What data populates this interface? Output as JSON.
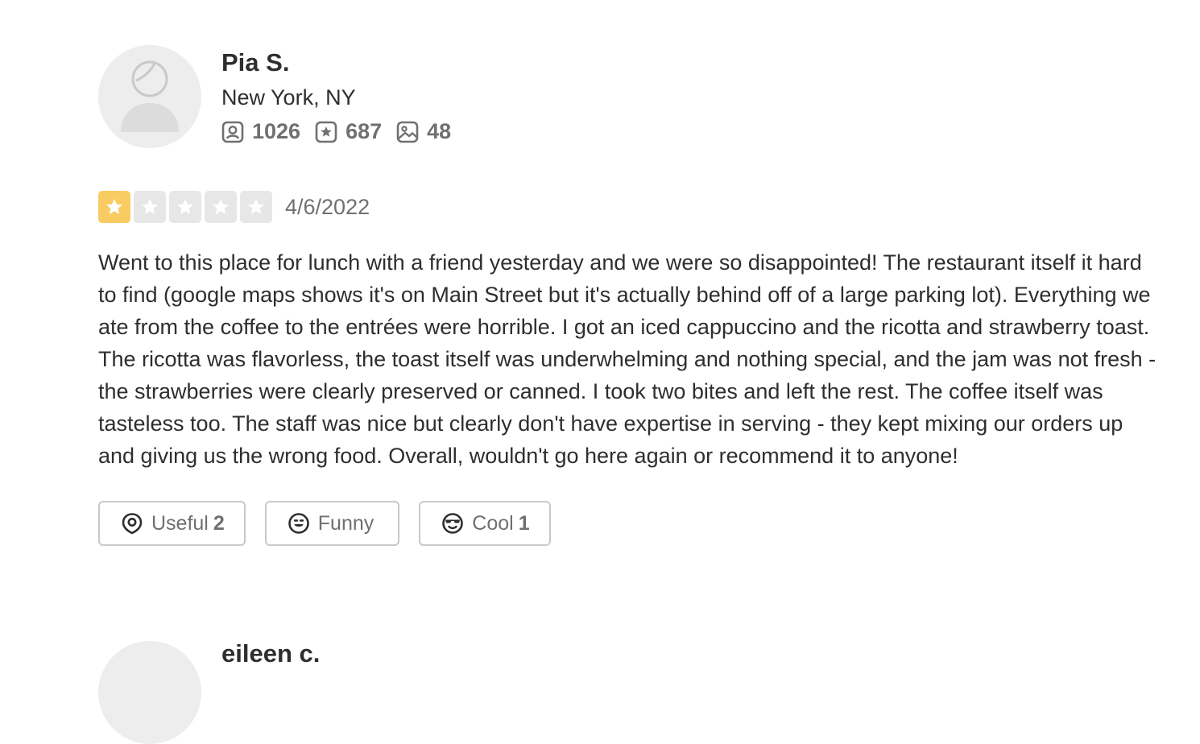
{
  "review": {
    "user": {
      "name": "Pia S.",
      "location": "New York, NY",
      "stats": {
        "friends": "1026",
        "reviews": "687",
        "photos": "48"
      }
    },
    "rating": 1,
    "rating_max": 5,
    "date": "4/6/2022",
    "text": "Went to this place for lunch with a friend yesterday and we were so disappointed! The restaurant itself it hard to find (google maps shows it's on Main Street but it's actually behind off of a large parking lot). Everything we ate from the coffee to the entrées were horrible. I got an iced cappuccino and the ricotta and strawberry toast. The ricotta was flavorless, the toast itself was underwhelming and nothing special, and the jam was not fresh - the strawberries were clearly preserved or canned. I took two bites and left the rest. The coffee itself was tasteless too. The staff was nice but clearly don't have expertise in serving - they kept mixing our orders up and giving us the wrong food. Overall, wouldn't go here again or recommend it to anyone!",
    "reactions": {
      "useful": {
        "label": "Useful",
        "count": "2"
      },
      "funny": {
        "label": "Funny",
        "count": ""
      },
      "cool": {
        "label": "Cool",
        "count": "1"
      }
    }
  },
  "next_review": {
    "name": "eileen c."
  },
  "colors": {
    "star_filled": "#f9cc62",
    "star_empty": "#e7e7e7",
    "text": "#2d2e2f",
    "muted": "#6e7072"
  },
  "icons": [
    "friends-icon",
    "reviews-icon",
    "photos-icon",
    "star-icon",
    "useful-icon",
    "funny-icon",
    "cool-icon"
  ]
}
